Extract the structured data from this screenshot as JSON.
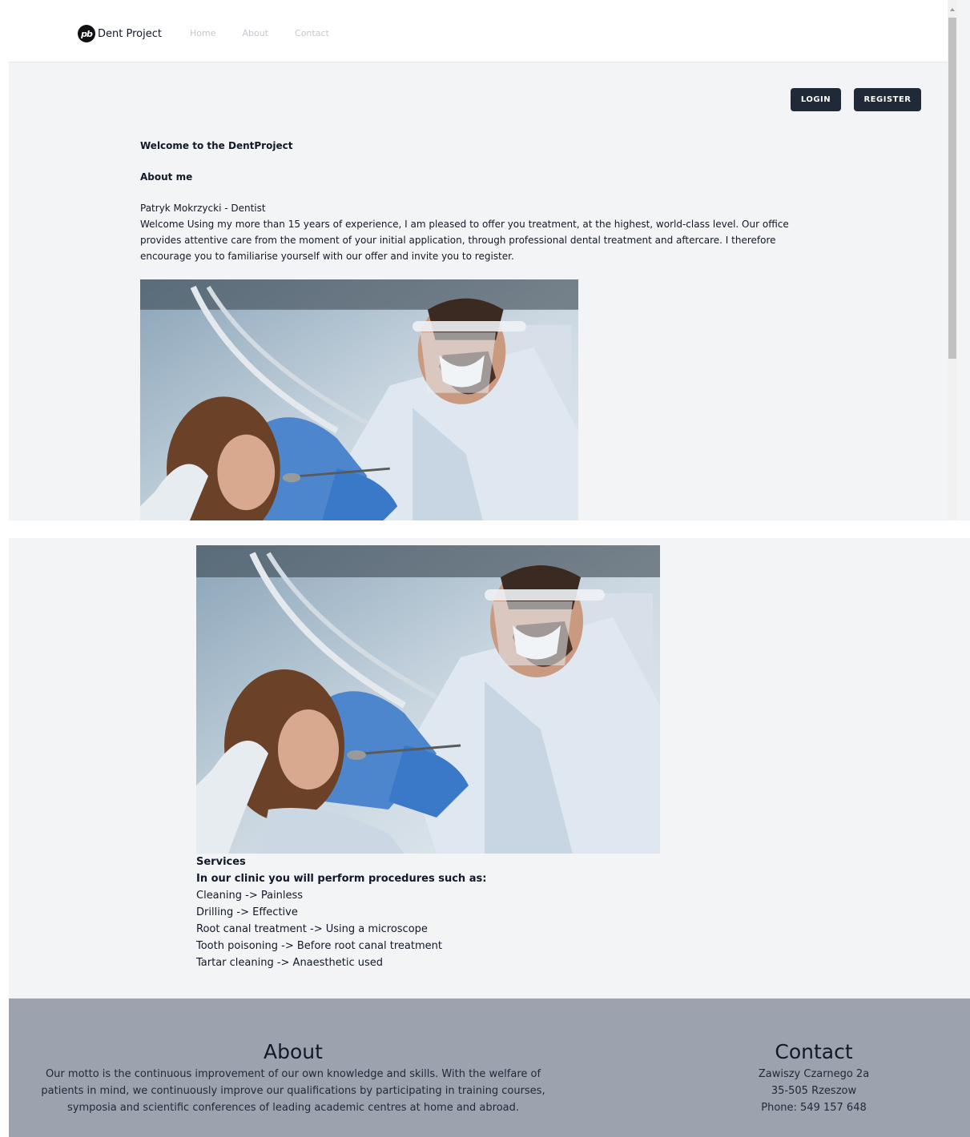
{
  "nav": {
    "brand_logo": "pb",
    "brand_name": "Dent Project",
    "links": [
      "Home",
      "About",
      "Contact"
    ]
  },
  "auth": {
    "login_label": "LOGIN",
    "register_label": "REGISTER"
  },
  "main": {
    "welcome_heading": "Welcome to the DentProject",
    "about_heading": "About me",
    "author_line": "Patryk Mokrzycki - Dentist",
    "bio": "Welcome Using my more than 15 years of experience, I am pleased to offer you treatment, at the highest, world-class level. Our office provides attentive care from the moment of your initial application, through professional dental treatment and aftercare. I therefore encourage you to familiarise yourself with our offer and invite you to register."
  },
  "services": {
    "title": "Services",
    "intro": "In our clinic you will perform procedures such as:",
    "items": [
      "Cleaning -> Painless",
      "Drilling -> Effective",
      "Root canal treatment -> Using a microscope",
      "Tooth poisoning -> Before root canal treatment",
      "Tartar cleaning -> Anaesthetic used"
    ]
  },
  "footer": {
    "about_title": "About",
    "about_lines": [
      "Our motto is the continuous improvement of our own knowledge and skills. With the welfare of",
      "patients in mind, we continuously improve our qualifications by participating in training courses,",
      "symposia and scientific conferences of leading academic centres at home and abroad."
    ],
    "contact_title": "Contact",
    "contact_lines": [
      "Zawiszy Czarnego 2a",
      "35-505 Rzeszow",
      "Phone: 549 157 648"
    ]
  },
  "colors": {
    "accent_button": "#1f2937",
    "page_background": "#f3f4f6",
    "footer_background": "#9ca3af",
    "nav_link": "#c4c8ce"
  }
}
